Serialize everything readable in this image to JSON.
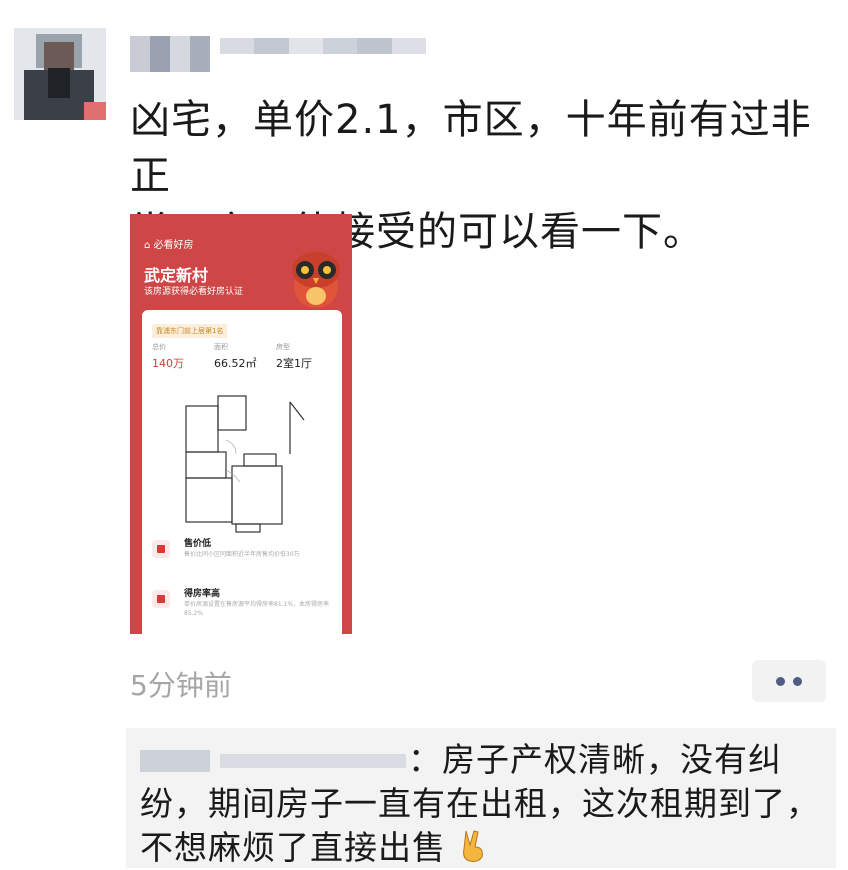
{
  "post": {
    "text_line1": "凶宅，单价2.1，市区，十年前有过非正",
    "text_line2": "常死亡，能接受的可以看一下。",
    "time": "5分钟前"
  },
  "card": {
    "brand": "必看好房",
    "title": "武定新村",
    "subtitle": "该房源获得必看好房认证",
    "tag": "靠浦东门前上居第1名",
    "stats": [
      {
        "label": "总价",
        "value": "140万"
      },
      {
        "label": "面积",
        "value": "66.52㎡"
      },
      {
        "label": "房型",
        "value": "2室1厅"
      }
    ],
    "features": [
      {
        "title": "售价低",
        "desc": "售价比同小区同面积近半年房售均价低30万"
      },
      {
        "title": "得房率高",
        "desc": "单价房源设置在售房源平均得房率81.1%，本房得房率85.2%"
      }
    ],
    "colors": {
      "brand_red": "#cf4646",
      "price_red": "#d63a3a"
    }
  },
  "comment": {
    "text": "：房子产权清晰，没有纠纷，期间房子一直有在出租，这次租期到了，不想麻烦了直接出售"
  }
}
